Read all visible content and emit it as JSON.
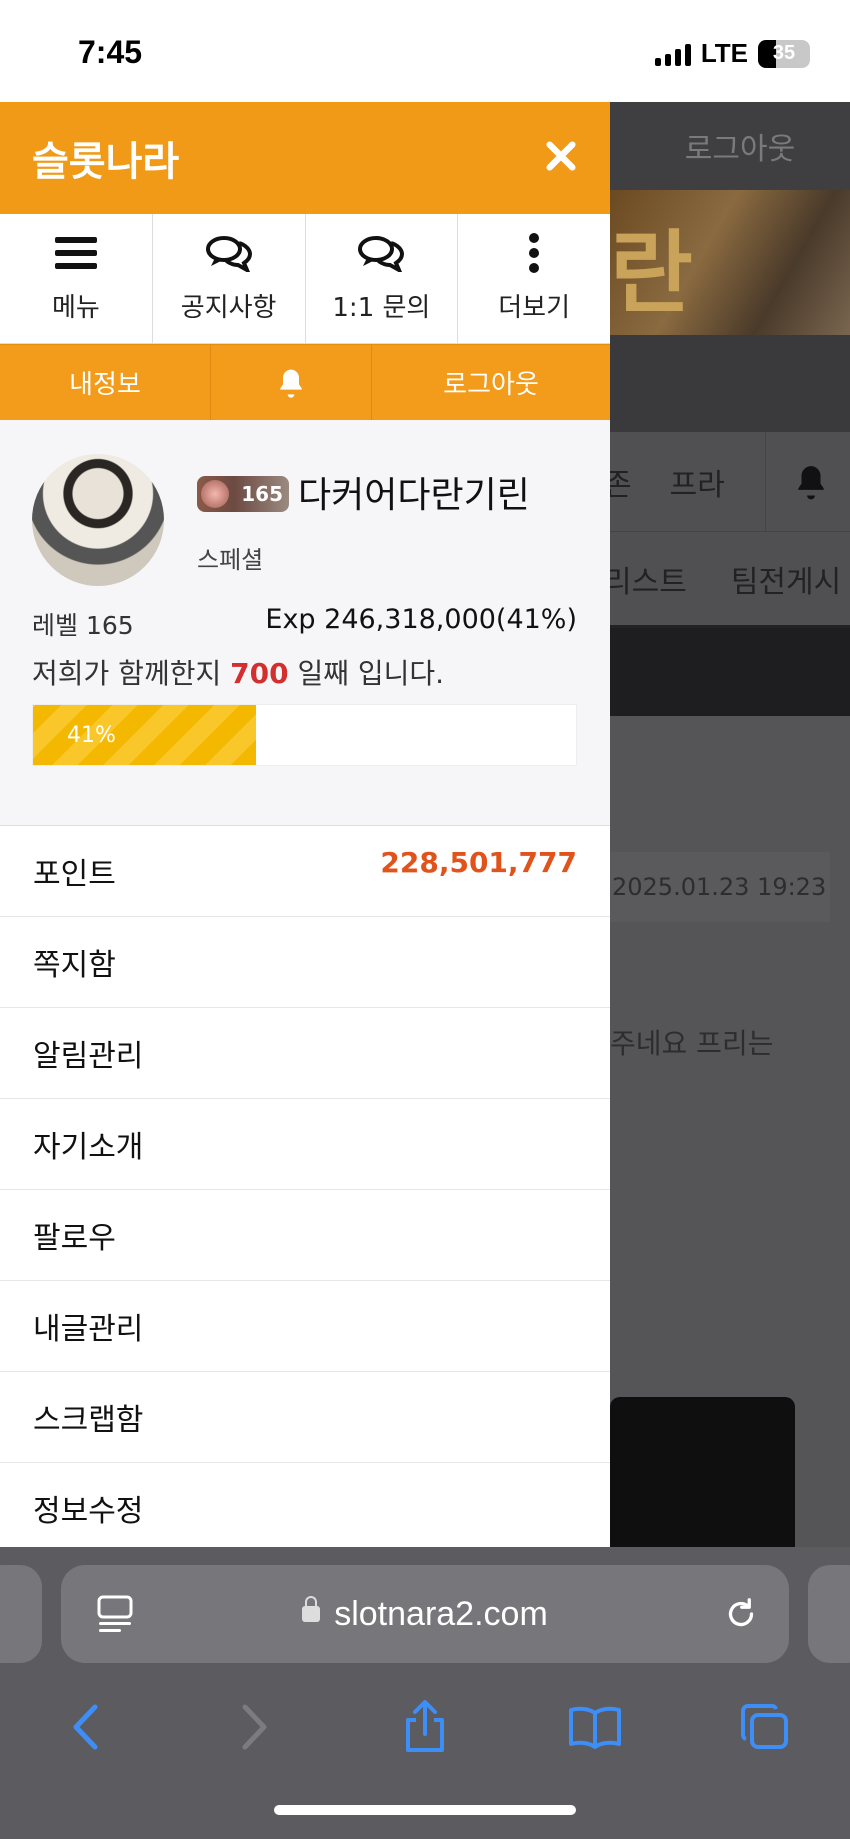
{
  "status_bar": {
    "time": "7:45",
    "network": "LTE",
    "battery": "35"
  },
  "background_page": {
    "logout_label": "로그아웃",
    "banner_char": "란",
    "nav_items": [
      "존",
      "프라"
    ],
    "nav2_items": [
      "리스트",
      "팀전게시"
    ],
    "date": "2025.01.23 19:23",
    "text_snippet": "주네요 프리는"
  },
  "drawer": {
    "title": "슬롯나라",
    "quick_menu": [
      {
        "label": "메뉴",
        "icon": "hamburger-icon"
      },
      {
        "label": "공지사항",
        "icon": "chat-bubbles-icon"
      },
      {
        "label": "1:1 문의",
        "icon": "chat-bubbles-icon"
      },
      {
        "label": "더보기",
        "icon": "more-vertical-icon"
      }
    ],
    "sub_bar": {
      "my_info": "내정보",
      "notification_icon": "bell-icon",
      "logout": "로그아웃"
    },
    "profile": {
      "level_badge": "165",
      "nickname": "다커어다란기린",
      "grade": "스페셜",
      "level_label": "레벨 165",
      "exp_label": "Exp 246,318,000(41%)",
      "days_prefix": "저희가 함께한지 ",
      "days_value": "700",
      "days_suffix": " 일째 입니다.",
      "progress_percent": 41,
      "progress_label": "41%"
    },
    "menu": [
      {
        "label": "포인트",
        "value": "228,501,777"
      },
      {
        "label": "쪽지함"
      },
      {
        "label": "알림관리"
      },
      {
        "label": "자기소개"
      },
      {
        "label": "팔로우"
      },
      {
        "label": "내글관리"
      },
      {
        "label": "스크랩함"
      },
      {
        "label": "정보수정"
      }
    ]
  },
  "browser": {
    "url": "slotnara2.com",
    "accent_color": "#3d8ef7"
  }
}
